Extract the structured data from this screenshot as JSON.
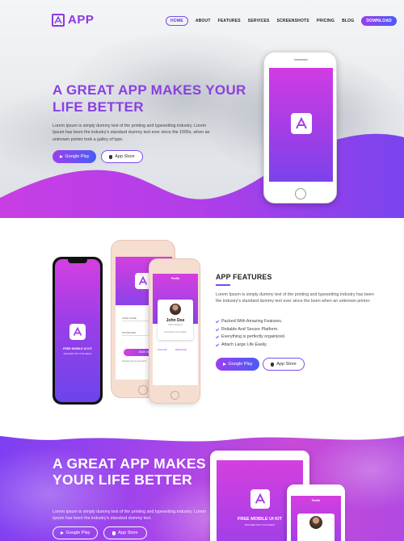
{
  "brand": {
    "name": "APP",
    "accent": "#8a39e6",
    "gradient_start": "#9b3ff0",
    "gradient_end": "#4a5cf5"
  },
  "nav": {
    "items": [
      "HOME",
      "ABOUT",
      "FEATURES",
      "SERVICES",
      "SCREENSHOTS",
      "PRICING",
      "BLOG"
    ],
    "active": "HOME",
    "download_label": "DOWNLOAD"
  },
  "hero": {
    "title": "A GREAT APP MAKES YOUR LIFE BETTER",
    "text": "Lorem Ipsum is simply dummy text of the printing and typesetting industry. Lorem Ipsum has been the industry's standard dummy text ever since the 1500s, when an unknown printer took a galley of type.",
    "google_play": "Google Play",
    "app_store": "App Store"
  },
  "mockups": {
    "free_kit_title": "FREE MOBILE UI KIT",
    "free_kit_sub": "DESIGNED FOR YOUR NEEDS",
    "field_user": "USER NAME",
    "field_password": "PASSWORD",
    "signin": "SIGN IN",
    "forgot": "Already have an account?",
    "profile_title": "Profile",
    "profile_name": "John Doe",
    "profile_role": "UI/UX Designer",
    "profile_desc": "Something more details",
    "follow": "FOLLOW",
    "message": "MESSAGE"
  },
  "features": {
    "title": "APP FEATURES",
    "text": "Lorem Ipsum is simply dummy text of the printing and typesetting industry has been the industry's standard dummy text ever since the been when an unknown printer.",
    "list": [
      "Packed With Amazing Features.",
      "Reliable And Secure Platform.",
      "Everything is perfectly orgainized.",
      "Attach Large Life Easily."
    ],
    "google_play": "Google Play",
    "app_store": "App Store"
  },
  "bottom": {
    "title": "A GREAT APP MAKES YOUR LIFE BETTER",
    "text": "Lorem Ipsum is simply dummy text of the printing and typesetting industry. Lorem Ipsum has been the industry's standard dummy text.",
    "google_play": "Google Play",
    "app_store": "App Store"
  }
}
